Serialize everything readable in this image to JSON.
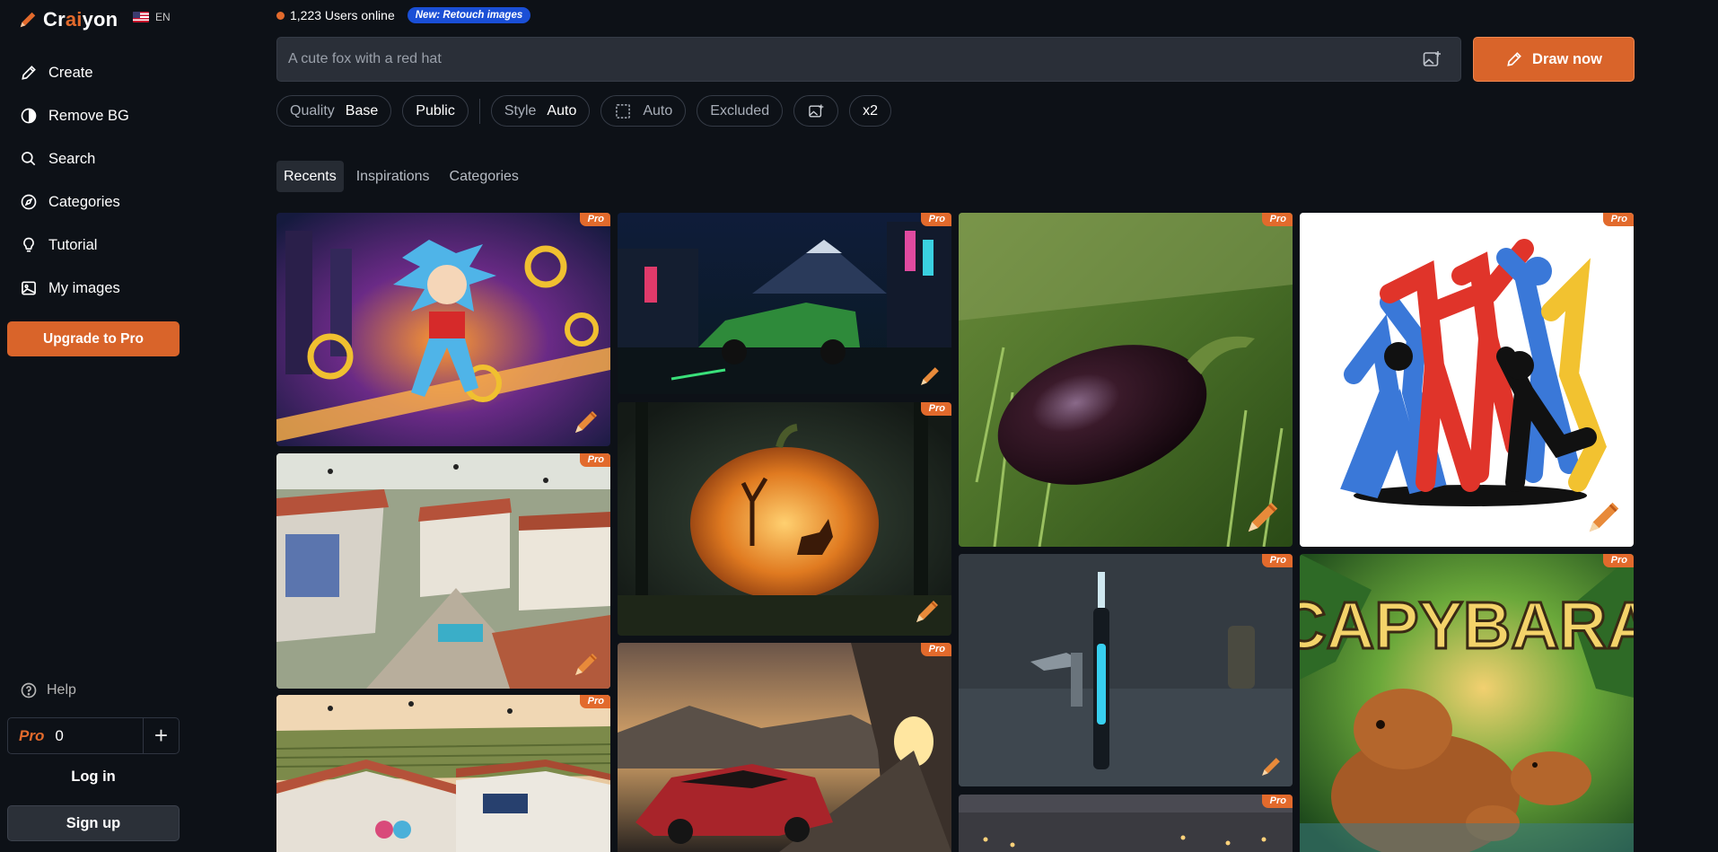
{
  "brand": {
    "name_pre": "Cr",
    "name_ai": "ai",
    "name_post": "yon",
    "lang": "EN"
  },
  "sidebar": {
    "items": [
      {
        "label": "Create",
        "icon": "pencil-icon"
      },
      {
        "label": "Remove BG",
        "icon": "contrast-icon"
      },
      {
        "label": "Search",
        "icon": "search-icon"
      },
      {
        "label": "Categories",
        "icon": "compass-icon"
      },
      {
        "label": "Tutorial",
        "icon": "lightbulb-icon"
      },
      {
        "label": "My images",
        "icon": "image-icon"
      }
    ],
    "upgrade_label": "Upgrade to Pro",
    "help_label": "Help",
    "credits_pro": "Pro",
    "credits_count": "0",
    "login_label": "Log in",
    "signup_label": "Sign up"
  },
  "header": {
    "online_text": "1,223 Users online",
    "badge_text": "New: Retouch images",
    "prompt_placeholder": "A cute fox with a red hat",
    "draw_label": "Draw now"
  },
  "options": {
    "quality_label": "Quality",
    "quality_value": "Base",
    "visibility": "Public",
    "style_label": "Style",
    "style_value": "Auto",
    "ratio_value": "Auto",
    "excluded_label": "Excluded",
    "multiplier": "x2"
  },
  "tabs": [
    "Recents",
    "Inspirations",
    "Categories"
  ],
  "gallery": {
    "pro_label": "Pro",
    "images": [
      {
        "subject": "hedgehog-hero-rings"
      },
      {
        "subject": "green-truck-neon-street"
      },
      {
        "subject": "eggplant-in-grass"
      },
      {
        "subject": "dancing-figures"
      },
      {
        "subject": "village-with-drones"
      },
      {
        "subject": "carved-pumpkin-forest"
      },
      {
        "subject": "electric-toothbrush"
      },
      {
        "subject": "capybara-poster",
        "text": "CAPYBARA"
      },
      {
        "subject": "vineyard-village"
      },
      {
        "subject": "red-sports-car-tunnel"
      },
      {
        "subject": "room-fairy-lights"
      }
    ]
  },
  "colors": {
    "accent": "#d9642a",
    "background": "#0d1117",
    "badge_blue": "#1a4fd6"
  }
}
